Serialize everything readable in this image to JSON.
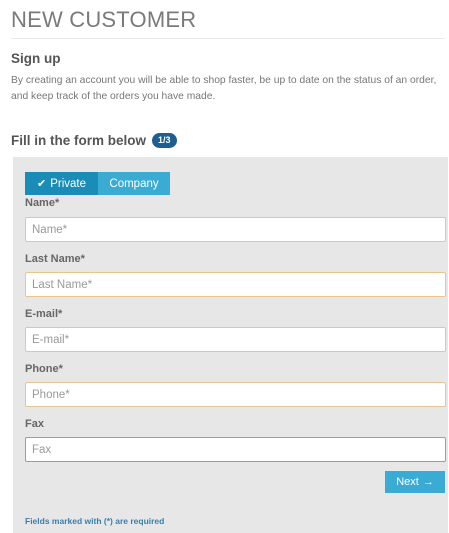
{
  "page": {
    "title": "NEW CUSTOMER",
    "signup_heading": "Sign up",
    "intro": "By creating an account you will be able to shop faster, be up to date on the status of an order, and keep track of the orders you have made.",
    "form_heading": "Fill in the form below",
    "step_badge": "1/3"
  },
  "form": {
    "account_type": {
      "options": [
        "Private",
        "Company"
      ],
      "selected": "Private"
    },
    "fields": [
      {
        "label": "Name*",
        "placeholder": "Name*",
        "value": ""
      },
      {
        "label": "Last Name*",
        "placeholder": "Last Name*",
        "value": ""
      },
      {
        "label": "E-mail*",
        "placeholder": "E-mail*",
        "value": ""
      },
      {
        "label": "Phone*",
        "placeholder": "Phone*",
        "value": ""
      },
      {
        "label": "Fax",
        "placeholder": "Fax",
        "value": ""
      }
    ],
    "next_label": "Next",
    "required_note": "Fields marked with (*) are required"
  },
  "colors": {
    "accent_dark": "#1a8cb8",
    "accent": "#3aabd2",
    "input_border": "#e8c48f",
    "input_focus_border": "#6fa8dc",
    "badge": "#1f5f8f"
  },
  "icons": {
    "private_check": "check-icon",
    "next_arrow": "arrow-right-icon"
  }
}
